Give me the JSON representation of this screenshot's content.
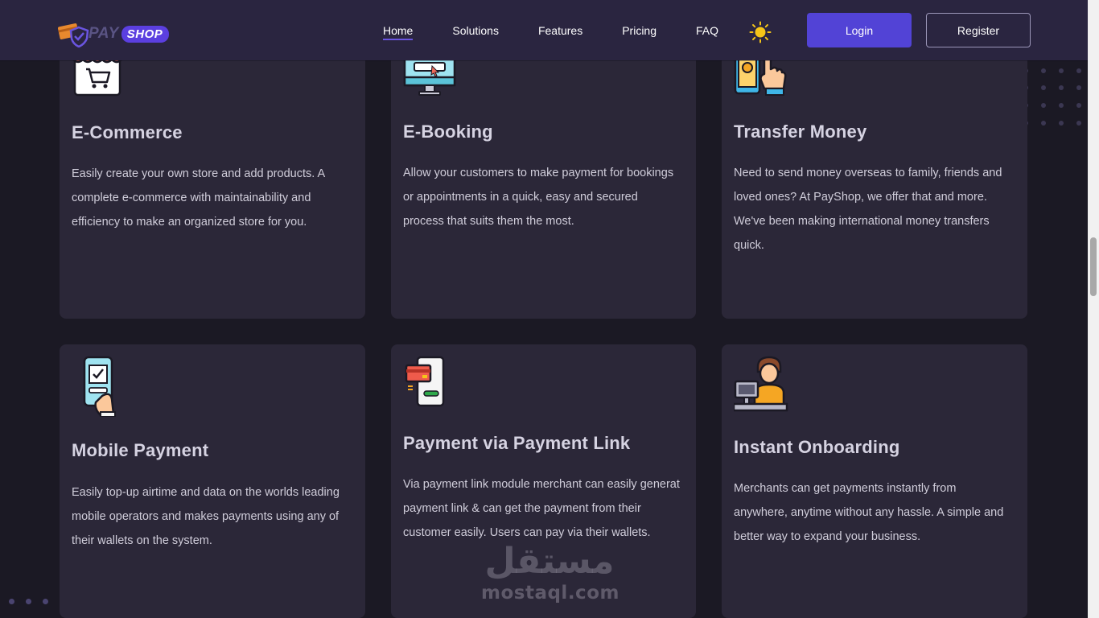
{
  "brand": {
    "pay": "PAY",
    "shop": "SHOP"
  },
  "nav": {
    "links": [
      "Home",
      "Solutions",
      "Features",
      "Pricing",
      "FAQ"
    ],
    "active": "Home",
    "login_label": "Login",
    "register_label": "Register",
    "theme_icon": "sun-icon"
  },
  "colors": {
    "navbar_bg": "#2a2540",
    "page_bg": "#1b1924",
    "card_bg": "#2b2738",
    "accent": "#5243d6"
  },
  "cards": [
    {
      "icon": "shop-cart-icon",
      "title": "E-Commerce",
      "text": "Easily create your own store and add products. A complete e-commerce with maintainability and efficiency to make an organized store for you."
    },
    {
      "icon": "monitor-click-icon",
      "title": "E-Booking",
      "text": "Allow your customers to make payment for bookings or appointments in a quick, easy and secured process that suits them the most."
    },
    {
      "icon": "phone-hand-money-icon",
      "title": "Transfer Money",
      "text": "Need to send money overseas to family, friends and loved ones? At PayShop, we offer that and more. We've been making international money transfers quick."
    },
    {
      "icon": "mobile-checklist-icon",
      "title": "Mobile Payment",
      "text": "Easily top-up airtime and data on the worlds leading mobile operators and makes payments using any of their wallets on the system."
    },
    {
      "icon": "card-phone-link-icon",
      "title": "Payment via Payment Link",
      "text": "Via payment link module merchant can easily generat payment link & can get the payment from their customer easily. Users can pay via their wallets."
    },
    {
      "icon": "cashier-person-icon",
      "title": "Instant Onboarding",
      "text": "Merchants can get payments instantly from anywhere, anytime without any hassle. A simple and better way to expand your business."
    }
  ],
  "watermark": {
    "arabic": "مستقل",
    "latin": "mostaql.com"
  }
}
